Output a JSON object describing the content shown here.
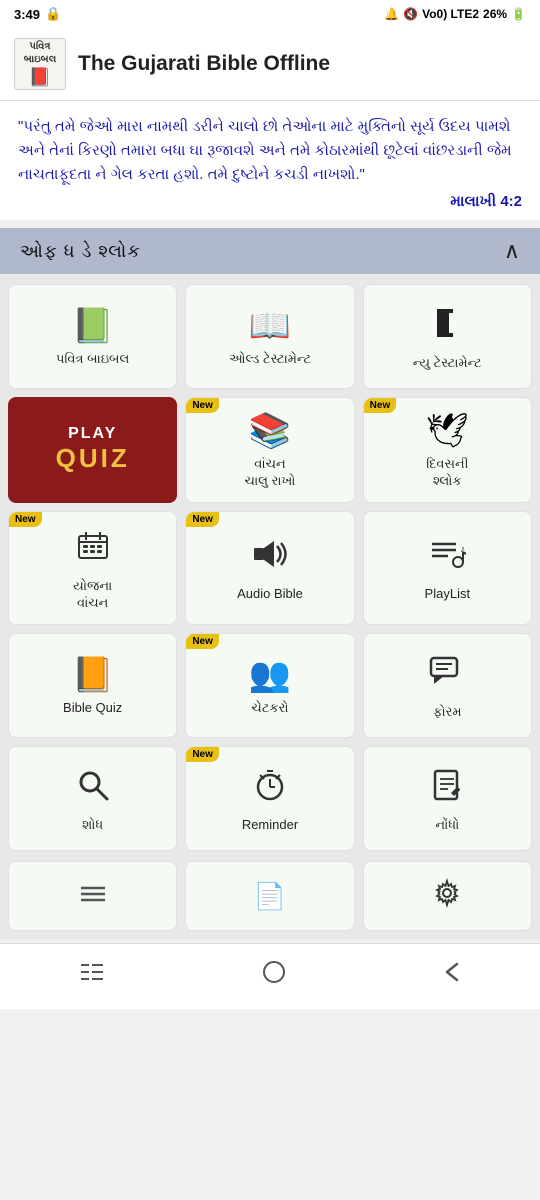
{
  "status": {
    "time": "3:49",
    "battery": "26%",
    "signal": "Vo0) LTE2"
  },
  "header": {
    "icon_line1": "પવિત્ર",
    "icon_line2": "બાઇબલ",
    "title": "The Gujarati Bible Offline"
  },
  "quote": {
    "text": "\"પરંતુ તમે જેઓ મારા નામથી ડરીને ચાલો છો તેઓના માટે મુક્તિનો સૂર્ય ઉદય પામશે અને તેનાં કિરણો તમારા બધા ઘા રૂજાવશે અને તમે કોઠારમાંથી છૂટેલાં વાંછરડાની જેમ નાચતાફૂદતા ને ગેલ કરતા હશો. તમે દુષ્ટોને કચડી નાખશો.\"",
    "reference": "માલાખી 4:2"
  },
  "verse_banner": {
    "text": "ઓફ ધ ડે શ્લોક",
    "arrow": "∧"
  },
  "grid": {
    "items": [
      {
        "id": "holy-bible",
        "icon": "📗",
        "label": "પવિત્ર બાઇબલ",
        "new": false,
        "special": false
      },
      {
        "id": "old-testament",
        "icon": "📖",
        "label": "ઓલ્ડ ટેસ્ટામેન્ટ",
        "new": false,
        "special": false
      },
      {
        "id": "new-testament",
        "icon": "🏛",
        "label": "ન્યુ ટેસ્ટામેન્ટ",
        "new": false,
        "special": false
      },
      {
        "id": "play-quiz",
        "icon": "",
        "label": "",
        "new": false,
        "special": "quiz"
      },
      {
        "id": "reading-continue",
        "icon": "📚",
        "label": "વાંચન\nચાલુ રાખો",
        "new": true,
        "special": false
      },
      {
        "id": "daily-verse",
        "icon": "🕊",
        "label": "દિવસની\nશ્લોક",
        "new": true,
        "special": false
      },
      {
        "id": "schedule-reading",
        "icon": "📅",
        "label": "યોજના\nવાંચન",
        "new": true,
        "special": false
      },
      {
        "id": "audio-bible",
        "icon": "🔊",
        "label": "Audio Bible",
        "new": true,
        "special": false
      },
      {
        "id": "playlist",
        "icon": "🎵",
        "label": "PlayList",
        "new": false,
        "special": false
      },
      {
        "id": "bible-quiz",
        "icon": "📙",
        "label": "Bible Quiz",
        "new": false,
        "special": false
      },
      {
        "id": "chatbot",
        "icon": "👥",
        "label": "ચેટકરો",
        "new": true,
        "special": false
      },
      {
        "id": "forum",
        "icon": "💬",
        "label": "ફોરમ",
        "new": false,
        "special": false
      },
      {
        "id": "search",
        "icon": "🔍",
        "label": "શોધ",
        "new": false,
        "special": false
      },
      {
        "id": "reminder",
        "icon": "⏰",
        "label": "Reminder",
        "new": true,
        "special": false
      },
      {
        "id": "notes",
        "icon": "📝",
        "label": "નોંધો",
        "new": false,
        "special": false
      }
    ]
  },
  "bottom_partial": [
    {
      "id": "partial1",
      "icon": "—"
    },
    {
      "id": "partial2",
      "icon": "📄"
    },
    {
      "id": "partial3",
      "icon": "⚙"
    }
  ],
  "bottom_nav": {
    "menu_icon": "|||",
    "home_icon": "○",
    "back_icon": "<"
  },
  "labels": {
    "new_badge": "New"
  }
}
